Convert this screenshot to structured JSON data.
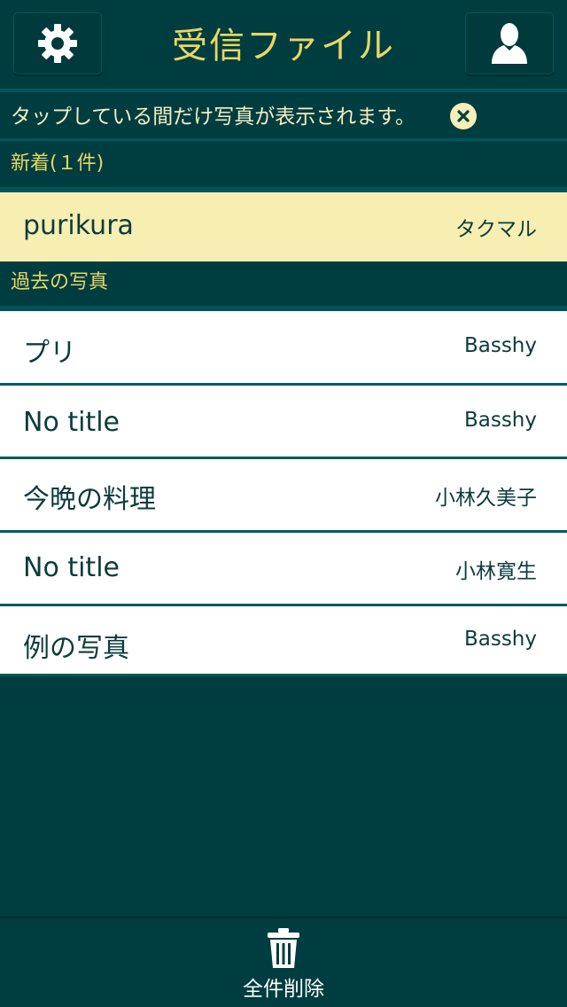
{
  "header": {
    "title": "受信ファイル",
    "settings_icon": "gear-icon",
    "profile_icon": "user-icon"
  },
  "notice": {
    "text": "タップしている間だけ写真が表示されます。",
    "close_icon": "close-circle-icon"
  },
  "sections": {
    "new_label": "新着(１件)",
    "past_label": "過去の写真"
  },
  "new_items": [
    {
      "title": "purikura",
      "sender": "タクマル"
    }
  ],
  "past_items": [
    {
      "title": "プリ",
      "sender": "Basshy"
    },
    {
      "title": "No title",
      "sender": "Basshy"
    },
    {
      "title": "今晩の料理",
      "sender": "小林久美子"
    },
    {
      "title": "No title",
      "sender": "小林寛生"
    },
    {
      "title": "例の写真",
      "sender": "Basshy"
    }
  ],
  "footer": {
    "delete_all_label": "全件削除",
    "trash_icon": "trash-icon"
  },
  "colors": {
    "background": "#003d40",
    "accent_yellow": "#e8d764",
    "new_row_bg": "#f7eeb2",
    "row_text": "#0c3c3c"
  }
}
